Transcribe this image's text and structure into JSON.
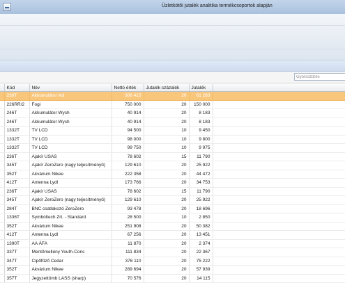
{
  "window": {
    "title": "Üzletkötői jutalék analitika termékcsoportok alapján"
  },
  "search": {
    "placeholder": "Gyorsszűrés"
  },
  "grid": {
    "columns": [
      "Kód",
      "Név",
      "Nettó érték",
      "Jutalék százalék",
      "Jutalék"
    ],
    "rows": [
      {
        "kod": "238T",
        "nev": "Akkumulátor Adi",
        "netto": "306 415",
        "szazalek": "20",
        "jutalek": "61 283",
        "selected": true
      },
      {
        "kod": "226RR/2",
        "nev": "Fogi",
        "netto": "750 000",
        "szazalek": "20",
        "jutalek": "150 000"
      },
      {
        "kod": "246T",
        "nev": "Akkumulátor Wysh",
        "netto": "40 914",
        "szazalek": "20",
        "jutalek": "8 183"
      },
      {
        "kod": "246T",
        "nev": "Akkumulátor Wysh",
        "netto": "40 914",
        "szazalek": "20",
        "jutalek": "8 183"
      },
      {
        "kod": "1332T",
        "nev": "TV LCD",
        "netto": "94 500",
        "szazalek": "10",
        "jutalek": "9 450"
      },
      {
        "kod": "1332T",
        "nev": "TV LCD",
        "netto": "98 000",
        "szazalek": "10",
        "jutalek": "9 800"
      },
      {
        "kod": "1332T",
        "nev": "TV LCD",
        "netto": "99 750",
        "szazalek": "10",
        "jutalek": "9 975"
      },
      {
        "kod": "236T",
        "nev": "Ajakír USAS",
        "netto": "78 602",
        "szazalek": "15",
        "jutalek": "11 790"
      },
      {
        "kod": "345T",
        "nev": "Ajakír ZeroZero (nagy teljesítményű)",
        "netto": "129 610",
        "szazalek": "20",
        "jutalek": "25 922"
      },
      {
        "kod": "352T",
        "nev": "Akvárium Nikee",
        "netto": "222 358",
        "szazalek": "20",
        "jutalek": "44 472"
      },
      {
        "kod": "412T",
        "nev": "Antenna Lydl",
        "netto": "173 766",
        "szazalek": "20",
        "jutalek": "34 753"
      },
      {
        "kod": "236T",
        "nev": "Ajakír USAS",
        "netto": "78 602",
        "szazalek": "15",
        "jutalek": "11 790"
      },
      {
        "kod": "345T",
        "nev": "Ajakír ZeroZero (nagy teljesítményű)",
        "netto": "129 610",
        "szazalek": "20",
        "jutalek": "25 922"
      },
      {
        "kod": "284T",
        "nev": "BNC csatlakozó ZeroZero",
        "netto": "93 478",
        "szazalek": "20",
        "jutalek": "18 696"
      },
      {
        "kod": "1336T",
        "nev": "Symbóltech Zrt. - Standard",
        "netto": "28 500",
        "szazalek": "10",
        "jutalek": "2 850"
      },
      {
        "kod": "352T",
        "nev": "Akvárium Nikee",
        "netto": "251 908",
        "szazalek": "20",
        "jutalek": "50 382"
      },
      {
        "kod": "412T",
        "nev": "Antenna Lydl",
        "netto": "67 256",
        "szazalek": "20",
        "jutalek": "13 451"
      },
      {
        "kod": "1390T",
        "nev": "AA ÁFA",
        "netto": "11 870",
        "szazalek": "20",
        "jutalek": "2 374"
      },
      {
        "kod": "337T",
        "nev": "Mentőmellény Youth-Cons",
        "netto": "111 834",
        "szazalek": "20",
        "jutalek": "22 367"
      },
      {
        "kod": "347T",
        "nev": "Cipőfűző Cedar",
        "netto": "376 110",
        "szazalek": "20",
        "jutalek": "75 222"
      },
      {
        "kod": "352T",
        "nev": "Akvárium Nikee",
        "netto": "289 694",
        "szazalek": "20",
        "jutalek": "57 939"
      },
      {
        "kod": "357T",
        "nev": "Jegyzettömb LASS (sharp)",
        "netto": "70 576",
        "szazalek": "20",
        "jutalek": "14 115"
      }
    ]
  }
}
